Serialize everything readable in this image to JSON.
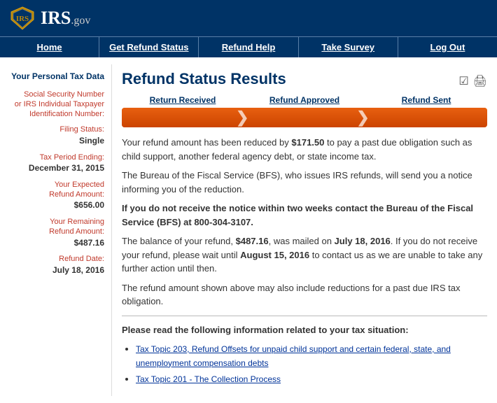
{
  "header": {
    "site": "IRS",
    "domain": ".gov"
  },
  "nav": {
    "items": [
      {
        "label": "Home",
        "id": "home"
      },
      {
        "label": "Get Refund Status",
        "id": "get-refund-status"
      },
      {
        "label": "Refund Help",
        "id": "refund-help"
      },
      {
        "label": "Take Survey",
        "id": "take-survey"
      },
      {
        "label": "Log Out",
        "id": "log-out"
      }
    ]
  },
  "sidebar": {
    "section_title": "Your Personal Tax Data",
    "fields": [
      {
        "label": "Social Security Number\nor IRS Individual Taxpayer\nIdentification Number:",
        "value": ""
      },
      {
        "label": "Filing Status:",
        "value": "Single"
      },
      {
        "label": "Tax Period Ending:",
        "value": "December 31, 2015"
      },
      {
        "label": "Your Expected\nRefund Amount:",
        "value": "$656.00"
      },
      {
        "label": "Your Remaining\nRefund Amount:",
        "value": "$487.16"
      },
      {
        "label": "Refund Date:",
        "value": "July 18, 2016"
      }
    ]
  },
  "content": {
    "page_title": "Refund Status Results",
    "progress": {
      "steps": [
        {
          "label": "Return Received"
        },
        {
          "label": "Refund Approved"
        },
        {
          "label": "Refund Sent"
        }
      ]
    },
    "paragraphs": [
      "Your refund amount has been reduced by <strong>$171.50</strong> to pay a past due obligation such as child support, another federal agency debt, or state income tax.",
      "The Bureau of the Fiscal Service (BFS), who issues IRS refunds, will send you a notice informing you of the reduction.",
      "<strong>If you do not receive the notice within two weeks contact the Bureau of the Fiscal Service (BFS) at 800-304-3107.</strong>",
      "The balance of your refund, <strong>$487.16</strong>, was mailed on <strong>July 18, 2016</strong>. If you do not receive your refund, please wait until <strong>August 15, 2016</strong> to contact us as we are unable to take any further action until then.",
      "The refund amount shown above may also include reductions for a past due IRS tax obligation."
    ],
    "read_section": {
      "title": "Please read the following information related to your tax situation:",
      "links": [
        {
          "text": "Tax Topic 203, Refund Offsets for unpaid child support and certain federal, state, and unemployment compensation debts",
          "href": "#"
        },
        {
          "text": "Tax Topic 201 - The Collection Process",
          "href": "#"
        }
      ]
    }
  }
}
